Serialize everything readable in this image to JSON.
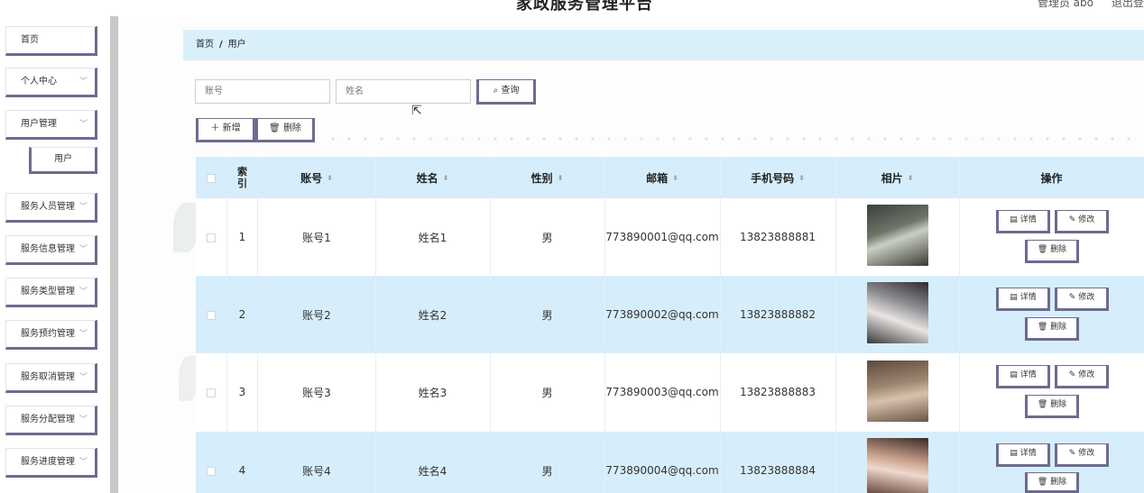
{
  "header": {
    "title": "家政服务管理平台",
    "user": "管理员 abo",
    "logout": "退出登"
  },
  "sidebar": {
    "items": [
      {
        "label": "首页",
        "expandable": false
      },
      {
        "label": "个人中心",
        "expandable": true
      },
      {
        "label": "用户管理",
        "expandable": true
      },
      {
        "label": "服务人员管理",
        "expandable": true
      },
      {
        "label": "服务信息管理",
        "expandable": true
      },
      {
        "label": "服务类型管理",
        "expandable": true
      },
      {
        "label": "服务预约管理",
        "expandable": true
      },
      {
        "label": "服务取消管理",
        "expandable": true
      },
      {
        "label": "服务分配管理",
        "expandable": true
      },
      {
        "label": "服务进度管理",
        "expandable": true
      }
    ],
    "sub_item": "用户"
  },
  "breadcrumb": {
    "home": "首页",
    "separator": "/",
    "current": "用户"
  },
  "search": {
    "account_placeholder": "账号",
    "name_placeholder": "姓名",
    "query_label": "查询",
    "query_icon": "search-icon"
  },
  "actions": {
    "add_label": "新增",
    "delete_label": "删除"
  },
  "table": {
    "columns": [
      "索引",
      "账号",
      "姓名",
      "性别",
      "邮箱",
      "手机号码",
      "相片",
      "操作"
    ],
    "rows": [
      {
        "index": "1",
        "account": "账号1",
        "name": "姓名1",
        "gender": "男",
        "email": "773890001@qq.com",
        "phone": "13823888881"
      },
      {
        "index": "2",
        "account": "账号2",
        "name": "姓名2",
        "gender": "男",
        "email": "773890002@qq.com",
        "phone": "13823888882"
      },
      {
        "index": "3",
        "account": "账号3",
        "name": "姓名3",
        "gender": "男",
        "email": "773890003@qq.com",
        "phone": "13823888883"
      },
      {
        "index": "4",
        "account": "账号4",
        "name": "姓名4",
        "gender": "男",
        "email": "773890004@qq.com",
        "phone": "13823888884"
      }
    ],
    "row_actions": {
      "detail": "详情",
      "edit": "修改",
      "delete": "删除"
    }
  },
  "colors": {
    "accent_border": "#6e6b8f",
    "header_bg": "#d6eefb",
    "breadcrumb_bg": "#d9f0fb"
  }
}
